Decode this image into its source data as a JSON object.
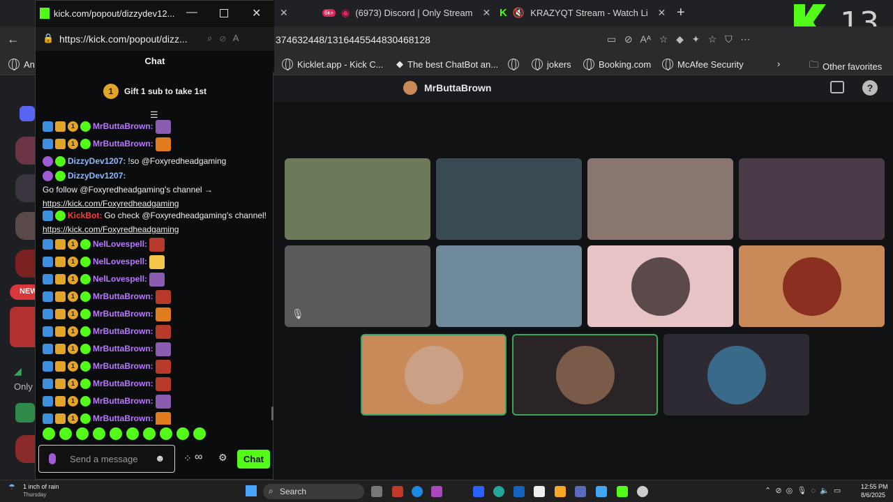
{
  "browser": {
    "tabs": [
      {
        "title": "(6973) Discord | Only Stream"
      },
      {
        "title": "KRAZYQT Stream - Watch Li"
      }
    ],
    "tab_badge": "6k+",
    "address_fragment": "374632448/1316445544830468128",
    "bookmarks": [
      "An",
      "Kicklet.app - Kick C...",
      "The best ChatBot an...",
      "jokers",
      "Booking.com",
      "McAfee Security",
      "Other favorites"
    ]
  },
  "overlay": {
    "number": "13"
  },
  "popout": {
    "title": "kick.com/popout/dizzydev12...",
    "url": "https://kick.com/popout/dizz...",
    "chat_header": "Chat",
    "gift_count": "1",
    "gift_text": "Gift 1 sub to take 1st",
    "messages": [
      {
        "user": "MrButtaBrown:",
        "cls": "user-purple",
        "badges": "full",
        "text": "",
        "emote": "e-misc"
      },
      {
        "user": "MrButtaBrown:",
        "cls": "user-purple",
        "badges": "full",
        "text": "",
        "emote": "e-lfg"
      },
      {
        "user": "DizzyDev1207:",
        "cls": "user-blue",
        "badges": "mod",
        "text": "!so @Foxyredheadgaming",
        "emote": ""
      },
      {
        "user": "DizzyDev1207:",
        "cls": "user-blue",
        "badges": "mod",
        "text": "Go follow @Foxyredheadgaming's channel → ",
        "link": "https://kick.com/Foxyredheadgaming",
        "emote": ""
      },
      {
        "user": "KickBot:",
        "cls": "user-red",
        "badges": "bot",
        "text": "Go check @Foxyredheadgaming's channel! ",
        "link": "https://kick.com/Foxyredheadgaming",
        "emote": ""
      },
      {
        "user": "NelLovespell:",
        "cls": "user-purple",
        "badges": "full",
        "text": "",
        "emote": "e-red"
      },
      {
        "user": "NelLovespell:",
        "cls": "user-purple",
        "badges": "full",
        "text": "",
        "emote": "e-pray"
      },
      {
        "user": "NelLovespell:",
        "cls": "user-purple",
        "badges": "full",
        "text": "",
        "emote": "e-misc"
      },
      {
        "user": "MrButtaBrown:",
        "cls": "user-purple",
        "badges": "full",
        "text": "",
        "emote": "e-red"
      },
      {
        "user": "MrButtaBrown:",
        "cls": "user-purple",
        "badges": "full",
        "text": "",
        "emote": "e-lfg"
      },
      {
        "user": "MrButtaBrown:",
        "cls": "user-purple",
        "badges": "full",
        "text": "",
        "emote": "e-red"
      },
      {
        "user": "MrButtaBrown:",
        "cls": "user-purple",
        "badges": "full",
        "text": "",
        "emote": "e-misc"
      },
      {
        "user": "MrButtaBrown:",
        "cls": "user-purple",
        "badges": "full",
        "text": "",
        "emote": "e-red"
      },
      {
        "user": "MrButtaBrown:",
        "cls": "user-purple",
        "badges": "full",
        "text": "",
        "emote": "e-red"
      },
      {
        "user": "MrButtaBrown:",
        "cls": "user-purple",
        "badges": "full",
        "text": "",
        "emote": "e-misc"
      },
      {
        "user": "MrButtaBrown:",
        "cls": "user-purple",
        "badges": "full",
        "text": "",
        "emote": "e-lfg"
      }
    ],
    "input_placeholder": "Send a message",
    "chat_button": "Chat"
  },
  "discord": {
    "stage_name": "MrButtaBrown",
    "side_text_1": "NEW",
    "side_text_2": "Only"
  },
  "taskbar": {
    "weather": "1 inch of rain",
    "weather_sub": "Thursday",
    "search": "Search",
    "time": "12:55 PM",
    "date": "8/6/2025"
  },
  "colors": {
    "kick_green": "#53fc18",
    "tile_tan": "#c98a5a",
    "tile_pink": "#e8c3c6"
  }
}
